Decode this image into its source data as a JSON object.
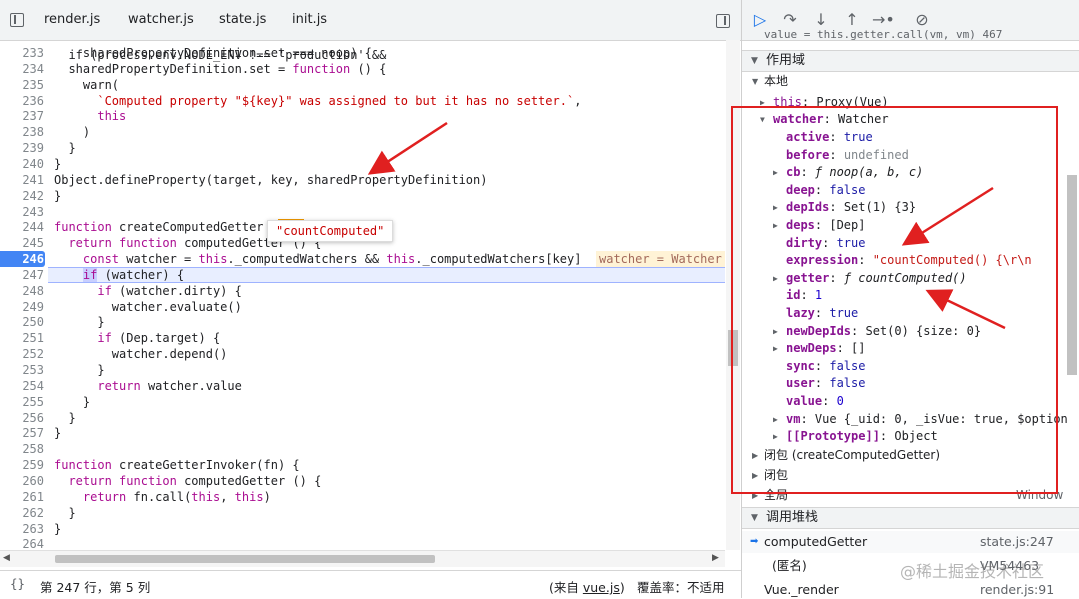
{
  "tabs": [
    "render.js",
    "watcher.js",
    "state.js",
    "init.js"
  ],
  "active_tab": "state.js",
  "code_lines": [
    {
      "n": "233",
      "t": "    sharedPropertyDefinition.set === noop) {"
    },
    {
      "n": "234",
      "t": "  sharedPropertyDefinition.set = function () {"
    },
    {
      "n": "235",
      "t": "    warn("
    },
    {
      "n": "236",
      "t": "      `Computed property \"${key}\" was assigned to but it has no setter.`,"
    },
    {
      "n": "237",
      "t": "      this"
    },
    {
      "n": "238",
      "t": "    )"
    },
    {
      "n": "239",
      "t": "  }"
    },
    {
      "n": "240",
      "t": "}"
    },
    {
      "n": "241",
      "t": "Object.defineProperty(target, key, sharedPropertyDefinition)"
    },
    {
      "n": "242",
      "t": "}"
    },
    {
      "n": "243",
      "t": ""
    },
    {
      "n": "244",
      "t": "function createComputedGetter (key) {"
    },
    {
      "n": "245",
      "t": "  return function computedGetter () {"
    },
    {
      "n": "246",
      "t": "    const watcher = this._computedWatchers && this._computedWatchers[key]"
    },
    {
      "n": "247",
      "t": "    if (watcher) {"
    },
    {
      "n": "248",
      "t": "      if (watcher.dirty) {"
    },
    {
      "n": "249",
      "t": "        watcher.evaluate()"
    },
    {
      "n": "250",
      "t": "      }"
    },
    {
      "n": "251",
      "t": "      if (Dep.target) {"
    },
    {
      "n": "252",
      "t": "        watcher.depend()"
    },
    {
      "n": "253",
      "t": "      }"
    },
    {
      "n": "254",
      "t": "      return watcher.value"
    },
    {
      "n": "255",
      "t": "    }"
    },
    {
      "n": "256",
      "t": "  }"
    },
    {
      "n": "257",
      "t": "}"
    },
    {
      "n": "258",
      "t": ""
    },
    {
      "n": "259",
      "t": "function createGetterInvoker(fn) {"
    },
    {
      "n": "260",
      "t": "  return function computedGetter () {"
    },
    {
      "n": "261",
      "t": "    return fn.call(this, this)"
    },
    {
      "n": "262",
      "t": "  }"
    },
    {
      "n": "263",
      "t": "}"
    },
    {
      "n": "264",
      "t": ""
    }
  ],
  "top_partial_line": "  if (process.env.NODE_ENV !== 'production' &&",
  "inline_value": "watcher = Watcher",
  "tooltip": "\"countComputed\"",
  "status": {
    "position": "第 247 行，第 5 列",
    "from_prefix": "(来自 ",
    "from_link": "vue.js",
    "from_suffix": ")",
    "coverage": "覆盖率：不适用"
  },
  "debugger": {
    "cut_line": "value = this.getter.call(vm, vm)   467",
    "scope_title": "作用域",
    "local_title": "本地",
    "this_row": {
      "key": "this",
      "value": "Proxy(Vue)"
    },
    "watcher_row": {
      "key": "watcher",
      "value": "Watcher"
    },
    "props": [
      {
        "k": "active",
        "v": "true",
        "cls": "bool",
        "exp": false
      },
      {
        "k": "before",
        "v": "undefined",
        "cls": "undef",
        "exp": false
      },
      {
        "k": "cb",
        "v": "ƒ noop(a, b, c)",
        "cls": "obj it",
        "exp": true
      },
      {
        "k": "deep",
        "v": "false",
        "cls": "bool",
        "exp": false
      },
      {
        "k": "depIds",
        "v": "Set(1) {3}",
        "cls": "obj",
        "exp": true
      },
      {
        "k": "deps",
        "v": "[Dep]",
        "cls": "obj",
        "exp": true
      },
      {
        "k": "dirty",
        "v": "true",
        "cls": "bool",
        "exp": false
      },
      {
        "k": "expression",
        "v": "\"countComputed() {\\r\\n",
        "cls": "strv",
        "exp": false
      },
      {
        "k": "getter",
        "v": "ƒ countComputed()",
        "cls": "obj it",
        "exp": true
      },
      {
        "k": "id",
        "v": "1",
        "cls": "num",
        "exp": false
      },
      {
        "k": "lazy",
        "v": "true",
        "cls": "bool",
        "exp": false
      },
      {
        "k": "newDepIds",
        "v": "Set(0) {size: 0}",
        "cls": "obj",
        "exp": true
      },
      {
        "k": "newDeps",
        "v": "[]",
        "cls": "obj",
        "exp": true
      },
      {
        "k": "sync",
        "v": "false",
        "cls": "bool",
        "exp": false
      },
      {
        "k": "user",
        "v": "false",
        "cls": "bool",
        "exp": false
      },
      {
        "k": "value",
        "v": "0",
        "cls": "num",
        "exp": false
      },
      {
        "k": "vm",
        "v": "Vue {_uid: 0, _isVue: true, $option",
        "cls": "obj",
        "exp": true
      },
      {
        "k": "[[Prototype]]",
        "v": "Object",
        "cls": "obj",
        "exp": true
      }
    ],
    "closure1": "闭包 (createComputedGetter)",
    "closure2": "闭包",
    "global": "全局",
    "global_value": "Window",
    "callstack_title": "调用堆栈",
    "stack": [
      {
        "fn": "computedGetter",
        "loc": "state.js:247",
        "active": true
      },
      {
        "fn": "(匿名)",
        "loc": "VM54463",
        "active": false
      },
      {
        "fn": "Vue._render",
        "loc": "render.js:91",
        "active": false
      }
    ]
  },
  "watermark": "@稀土掘金技术社区"
}
